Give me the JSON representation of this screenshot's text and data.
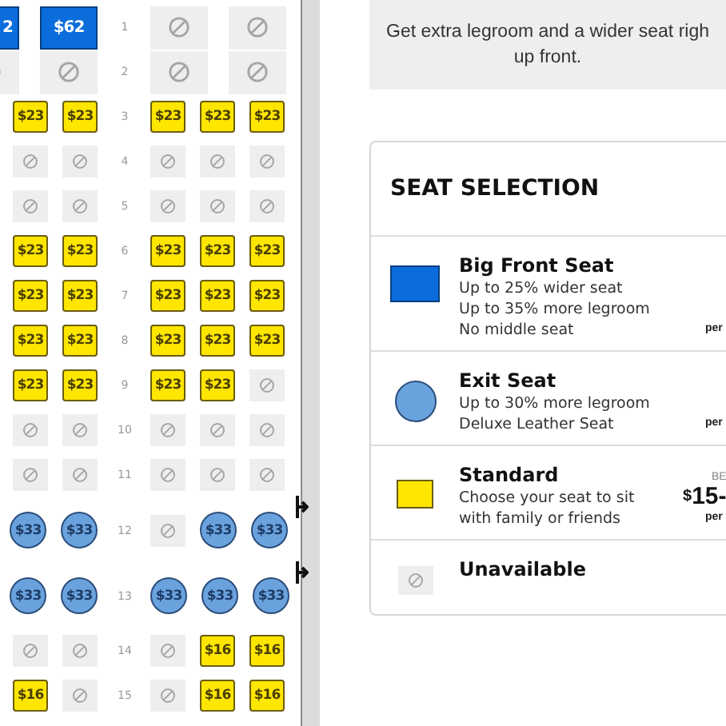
{
  "seat_map": {
    "rows": [
      {
        "number": "1",
        "kind": "front",
        "left": [
          {
            "kind": "big",
            "price": "2"
          },
          {
            "kind": "big",
            "price": "$62"
          }
        ],
        "right": [
          {
            "kind": "unavailable"
          },
          {
            "kind": "unavailable"
          }
        ]
      },
      {
        "number": "2",
        "kind": "front",
        "left": [
          {
            "kind": "unavailable"
          },
          {
            "kind": "unavailable"
          }
        ],
        "right": [
          {
            "kind": "unavailable"
          },
          {
            "kind": "unavailable"
          }
        ]
      },
      {
        "number": "3",
        "kind": "standard",
        "left": [
          {
            "kind": "standard",
            "price": "$23"
          },
          {
            "kind": "standard",
            "price": "$23"
          }
        ],
        "right": [
          {
            "kind": "standard",
            "price": "$23"
          },
          {
            "kind": "standard",
            "price": "$23"
          },
          {
            "kind": "standard",
            "price": "$23"
          }
        ]
      },
      {
        "number": "4",
        "kind": "standard",
        "left": [
          {
            "kind": "unavailable"
          },
          {
            "kind": "unavailable"
          }
        ],
        "right": [
          {
            "kind": "unavailable"
          },
          {
            "kind": "unavailable"
          },
          {
            "kind": "unavailable"
          }
        ]
      },
      {
        "number": "5",
        "kind": "standard",
        "left": [
          {
            "kind": "unavailable"
          },
          {
            "kind": "unavailable"
          }
        ],
        "right": [
          {
            "kind": "unavailable"
          },
          {
            "kind": "unavailable"
          },
          {
            "kind": "unavailable"
          }
        ]
      },
      {
        "number": "6",
        "kind": "standard",
        "left": [
          {
            "kind": "standard",
            "price": "$23"
          },
          {
            "kind": "standard",
            "price": "$23"
          }
        ],
        "right": [
          {
            "kind": "standard",
            "price": "$23"
          },
          {
            "kind": "standard",
            "price": "$23"
          },
          {
            "kind": "standard",
            "price": "$23"
          }
        ]
      },
      {
        "number": "7",
        "kind": "standard",
        "left": [
          {
            "kind": "standard",
            "price": "$23"
          },
          {
            "kind": "standard",
            "price": "$23"
          }
        ],
        "right": [
          {
            "kind": "standard",
            "price": "$23"
          },
          {
            "kind": "standard",
            "price": "$23"
          },
          {
            "kind": "standard",
            "price": "$23"
          }
        ]
      },
      {
        "number": "8",
        "kind": "standard",
        "left": [
          {
            "kind": "standard",
            "price": "$23"
          },
          {
            "kind": "standard",
            "price": "$23"
          }
        ],
        "right": [
          {
            "kind": "standard",
            "price": "$23"
          },
          {
            "kind": "standard",
            "price": "$23"
          },
          {
            "kind": "standard",
            "price": "$23"
          }
        ]
      },
      {
        "number": "9",
        "kind": "standard",
        "left": [
          {
            "kind": "standard",
            "price": "$23"
          },
          {
            "kind": "standard",
            "price": "$23"
          }
        ],
        "right": [
          {
            "kind": "standard",
            "price": "$23"
          },
          {
            "kind": "standard",
            "price": "$23"
          },
          {
            "kind": "unavailable"
          }
        ]
      },
      {
        "number": "10",
        "kind": "standard",
        "left": [
          {
            "kind": "unavailable"
          },
          {
            "kind": "unavailable"
          }
        ],
        "right": [
          {
            "kind": "unavailable"
          },
          {
            "kind": "unavailable"
          },
          {
            "kind": "unavailable"
          }
        ]
      },
      {
        "number": "11",
        "kind": "standard",
        "left": [
          {
            "kind": "unavailable"
          },
          {
            "kind": "unavailable"
          }
        ],
        "right": [
          {
            "kind": "unavailable"
          },
          {
            "kind": "unavailable"
          },
          {
            "kind": "unavailable"
          }
        ]
      },
      {
        "number": "12",
        "kind": "exit",
        "left": [
          {
            "kind": "exit",
            "price": "$33"
          },
          {
            "kind": "exit",
            "price": "$33"
          }
        ],
        "right": [
          {
            "kind": "unavailable"
          },
          {
            "kind": "exit",
            "price": "$33"
          },
          {
            "kind": "exit",
            "price": "$33"
          }
        ]
      },
      {
        "number": "13",
        "kind": "exit",
        "left": [
          {
            "kind": "exit",
            "price": "$33"
          },
          {
            "kind": "exit",
            "price": "$33"
          }
        ],
        "right": [
          {
            "kind": "exit",
            "price": "$33"
          },
          {
            "kind": "exit",
            "price": "$33"
          },
          {
            "kind": "exit",
            "price": "$33"
          }
        ]
      },
      {
        "number": "14",
        "kind": "standard",
        "left": [
          {
            "kind": "unavailable"
          },
          {
            "kind": "unavailable"
          }
        ],
        "right": [
          {
            "kind": "unavailable"
          },
          {
            "kind": "standard",
            "price": "$16"
          },
          {
            "kind": "standard",
            "price": "$16"
          }
        ]
      },
      {
        "number": "15",
        "kind": "standard",
        "left": [
          {
            "kind": "standard",
            "price": "$16"
          },
          {
            "kind": "unavailable"
          }
        ],
        "right": [
          {
            "kind": "unavailable"
          },
          {
            "kind": "standard",
            "price": "$16"
          },
          {
            "kind": "standard",
            "price": "$16"
          }
        ]
      }
    ]
  },
  "banner": {
    "lines": [
      "Get extra legroom and a wider seat righ",
      "up front."
    ]
  },
  "legend": {
    "title": "SEAT SELECTION",
    "items": [
      {
        "kind": "big",
        "name": "Big Front Seat",
        "lines": [
          "Up to 25% wider seat",
          "Up to 35% more legroom",
          "No middle seat"
        ],
        "per": "per"
      },
      {
        "kind": "exit",
        "name": "Exit Seat",
        "lines": [
          "Up to 30% more legroom",
          "Deluxe Leather Seat"
        ],
        "per": "per"
      },
      {
        "kind": "standard",
        "name": "Standard",
        "lines": [
          "Choose your seat to sit",
          "with family or friends"
        ],
        "from": "BE",
        "currency": "$",
        "amount": "15-",
        "per": "per"
      },
      {
        "kind": "unavailable",
        "name": "Unavailable"
      }
    ]
  }
}
